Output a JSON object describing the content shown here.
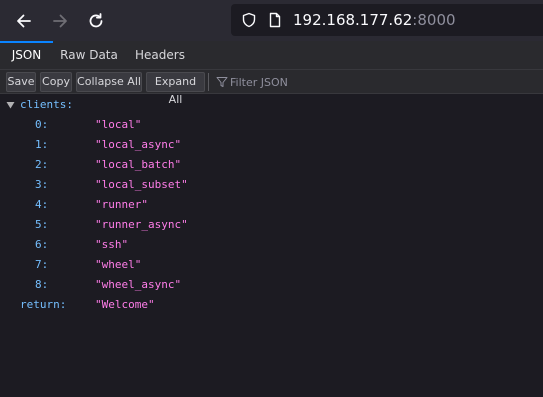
{
  "browser": {
    "url_host": "192.168.177.62",
    "url_port": ":8000",
    "icons": [
      "back-arrow-icon",
      "forward-arrow-icon",
      "reload-icon",
      "shield-icon",
      "page-icon"
    ]
  },
  "viewer": {
    "tabs": [
      {
        "label": "JSON",
        "active": true
      },
      {
        "label": "Raw Data",
        "active": false
      },
      {
        "label": "Headers",
        "active": false
      }
    ],
    "toolbar": {
      "save": "Save",
      "copy": "Copy",
      "collapse_all": "Collapse All",
      "expand_all": "Expand All",
      "filter_placeholder": "Filter JSON"
    },
    "colors": {
      "key": "#75bfff",
      "string": "#ff7de9",
      "accent": "#0a84ff"
    }
  },
  "json": {
    "clients_key": "clients:",
    "clients": [
      {
        "index": "0:",
        "value": "\"local\""
      },
      {
        "index": "1:",
        "value": "\"local_async\""
      },
      {
        "index": "2:",
        "value": "\"local_batch\""
      },
      {
        "index": "3:",
        "value": "\"local_subset\""
      },
      {
        "index": "4:",
        "value": "\"runner\""
      },
      {
        "index": "5:",
        "value": "\"runner_async\""
      },
      {
        "index": "6:",
        "value": "\"ssh\""
      },
      {
        "index": "7:",
        "value": "\"wheel\""
      },
      {
        "index": "8:",
        "value": "\"wheel_async\""
      }
    ],
    "return_key": "return:",
    "return_value": "\"Welcome\""
  }
}
